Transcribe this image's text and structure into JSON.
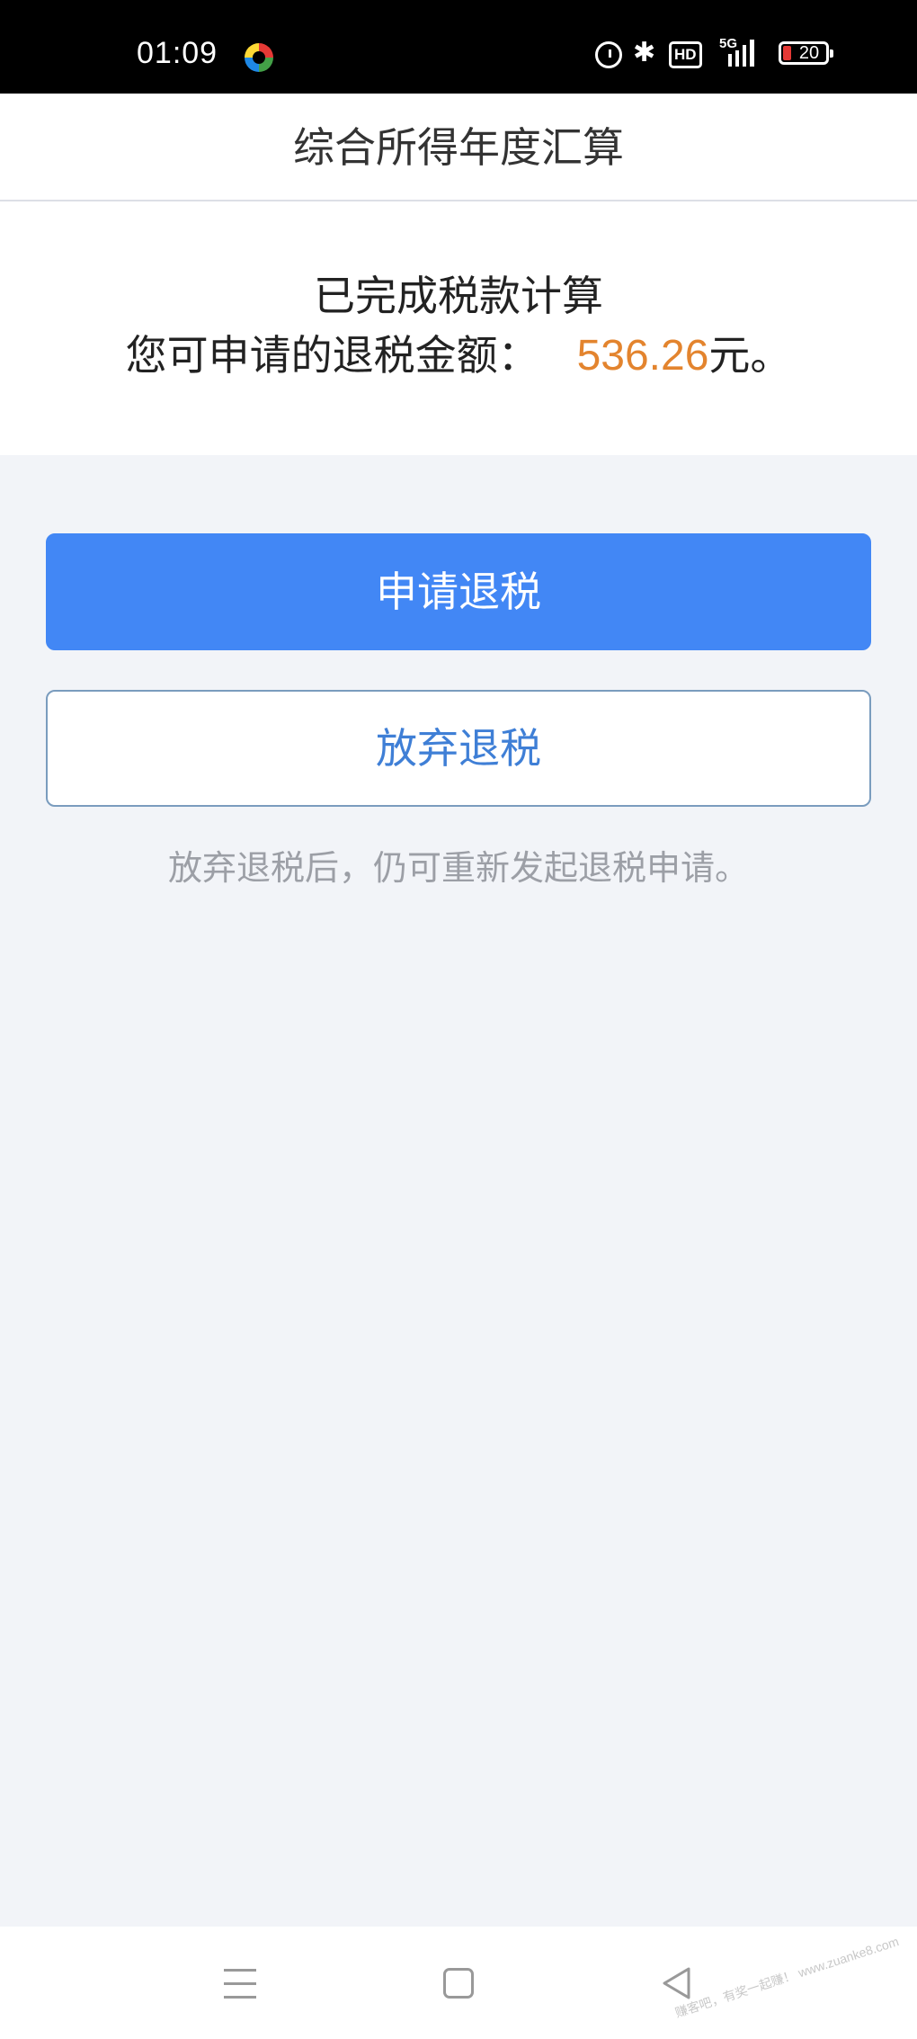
{
  "status_bar": {
    "time": "01:09",
    "app_icon": "colorful-app-icon",
    "icons": [
      "alarm-icon",
      "bluetooth-icon",
      "hd-icon",
      "5g-signal-icon",
      "battery-icon"
    ],
    "hd_label": "HD",
    "network_label": "5G",
    "battery_level": "20"
  },
  "header": {
    "title": "综合所得年度汇算"
  },
  "summary": {
    "line1": "已完成税款计算",
    "label": "您可申请的退税金额：",
    "amount": "536.26",
    "unit": "元。",
    "amount_color": "#e3842e"
  },
  "actions": {
    "apply_label": "申请退税",
    "abandon_label": "放弃退税",
    "hint": "放弃退税后，仍可重新发起退税申请。",
    "primary_color": "#4287f5"
  },
  "nav_bar": {
    "icons": [
      "menu-icon",
      "home-icon",
      "back-icon"
    ],
    "watermark": "赚客吧，有奖一起赚！ www.zuanke8.com"
  }
}
